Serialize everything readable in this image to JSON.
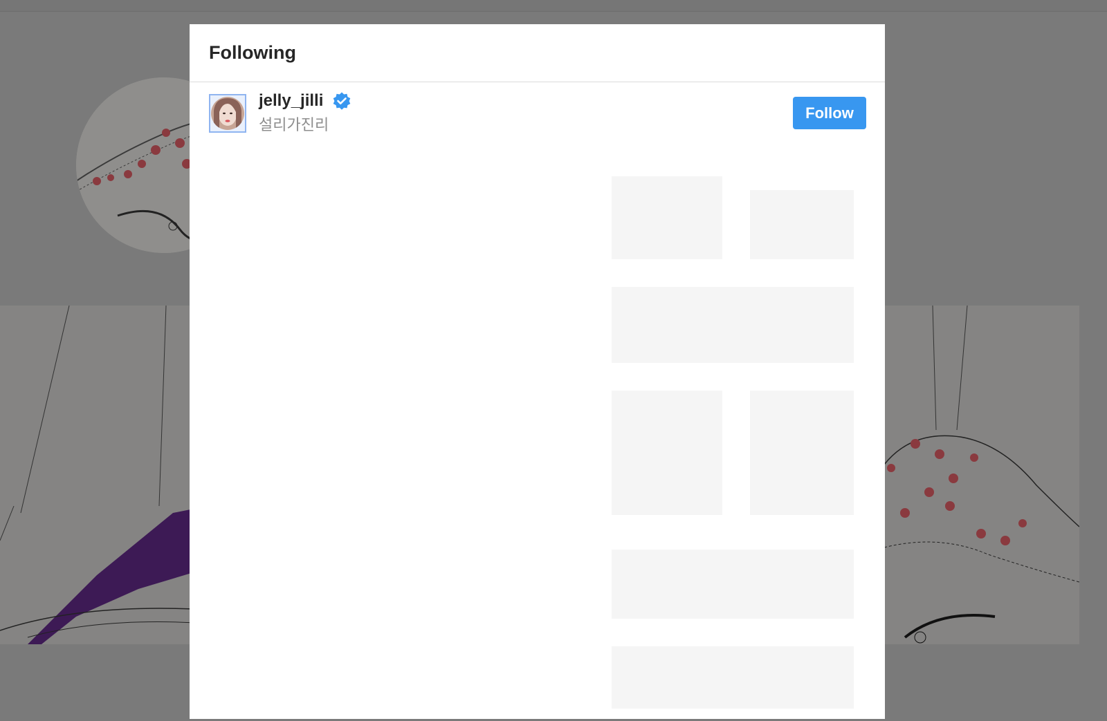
{
  "modal": {
    "title": "Following",
    "users": [
      {
        "username": "jelly_jilli",
        "full_name": "설리가진리",
        "verified": true,
        "follow_label": "Follow",
        "avatar_icon": "profile-photo"
      }
    ]
  },
  "colors": {
    "overlay": "#7a7a7a",
    "modal_bg": "#ffffff",
    "accent": "#3897f0",
    "primary_text": "#262626",
    "secondary_text": "#8e8e8e",
    "divider": "#dbdbdb"
  },
  "icons": {
    "verified": "verified-badge-icon"
  }
}
